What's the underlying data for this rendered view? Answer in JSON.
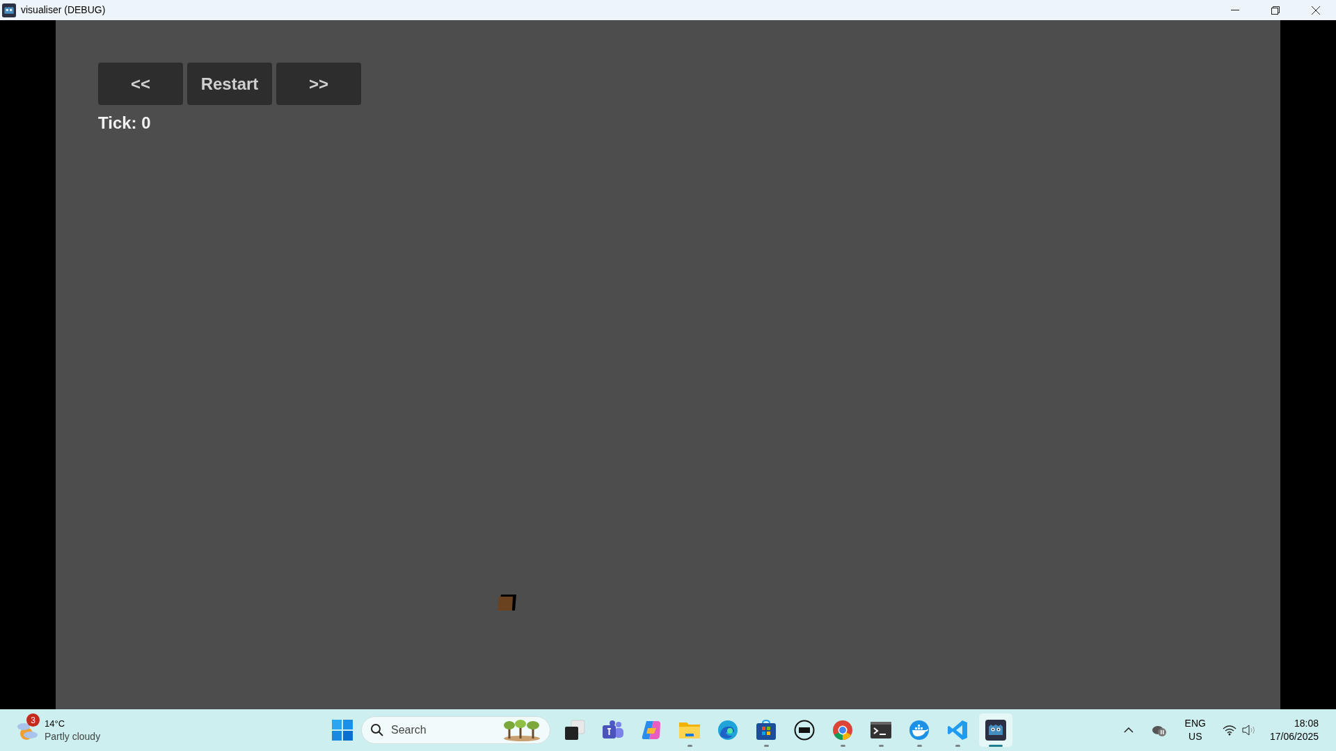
{
  "window": {
    "title": "visualiser (DEBUG)"
  },
  "toolbar": {
    "buttons": [
      "<<",
      "Restart",
      ">>"
    ]
  },
  "tick_label": "Tick: 0",
  "taskbar": {
    "weather": {
      "temperature": "14°C",
      "condition": "Partly cloudy",
      "badge": "3"
    },
    "search": {
      "placeholder": "Search"
    },
    "apps": [
      {
        "kind": "taskview",
        "running": false,
        "selected": false
      },
      {
        "kind": "teams",
        "running": false,
        "selected": false
      },
      {
        "kind": "copilot",
        "running": false,
        "selected": false
      },
      {
        "kind": "folder",
        "running": true,
        "selected": false
      },
      {
        "kind": "edge",
        "running": false,
        "selected": false
      },
      {
        "kind": "store",
        "running": true,
        "selected": false
      },
      {
        "kind": "dell",
        "running": false,
        "selected": false
      },
      {
        "kind": "chrome",
        "running": true,
        "selected": false
      },
      {
        "kind": "terminal",
        "running": true,
        "selected": false
      },
      {
        "kind": "docker",
        "running": true,
        "selected": false
      },
      {
        "kind": "vscode",
        "running": true,
        "selected": false
      },
      {
        "kind": "godot",
        "running": true,
        "selected": true
      }
    ],
    "language": [
      "ENG",
      "US"
    ],
    "time": "18:08",
    "date": "17/06/2025"
  }
}
